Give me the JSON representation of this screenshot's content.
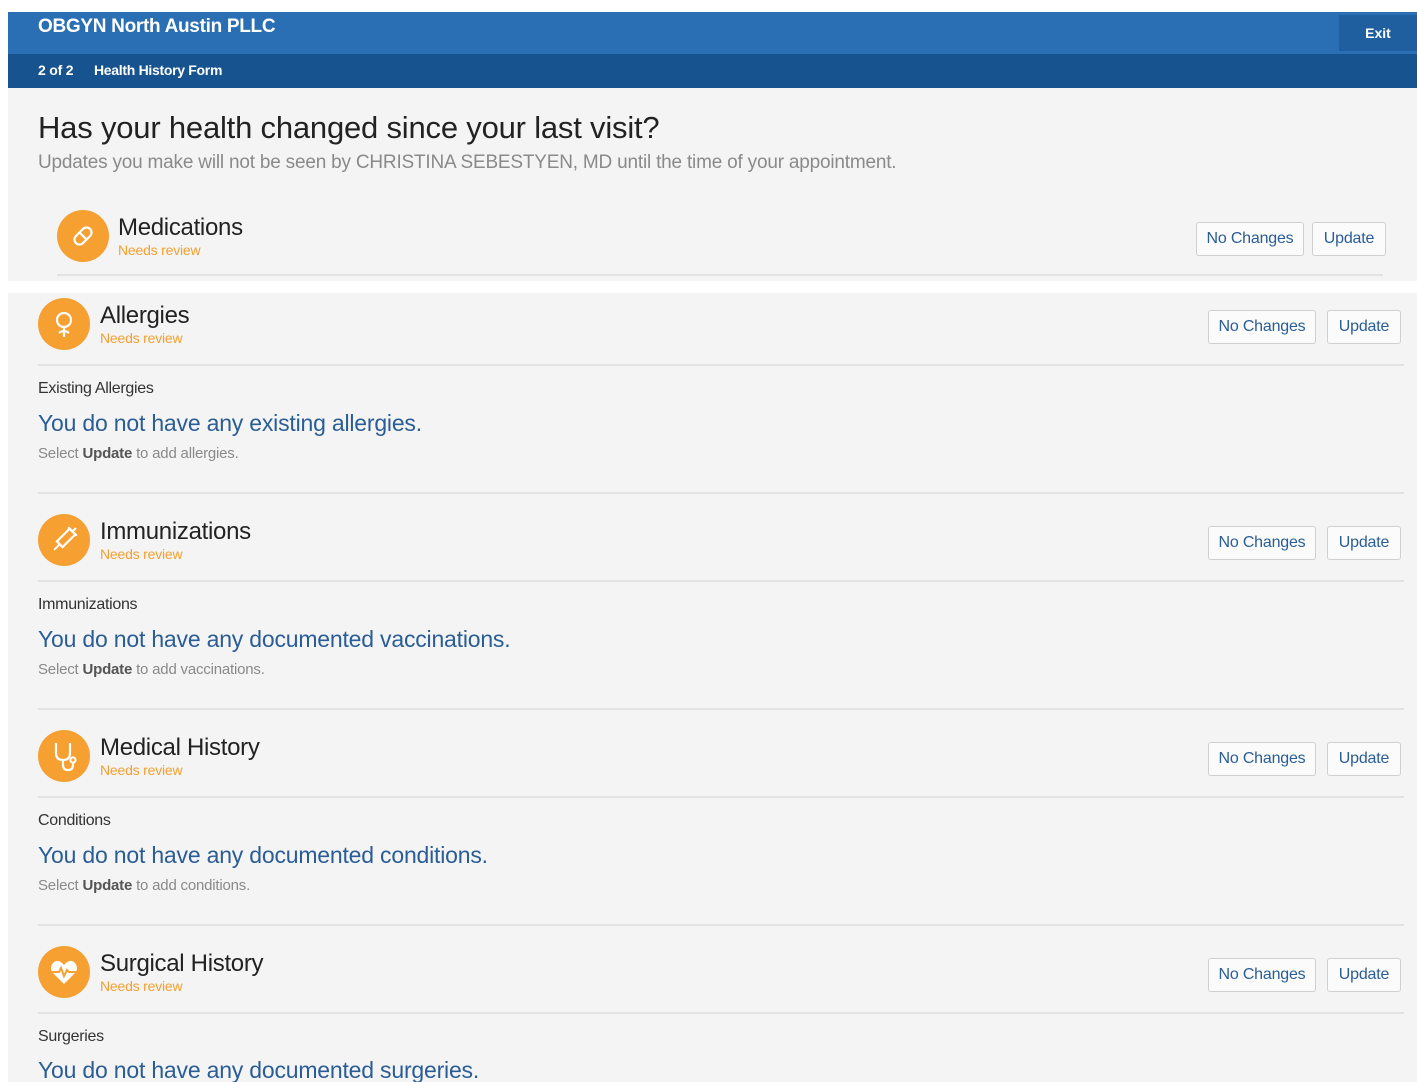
{
  "header": {
    "practice_name": "OBGYN North Austin PLLC",
    "exit_label": "Exit",
    "step": "2 of 2",
    "form_name": "Health History Form"
  },
  "page": {
    "title": "Has your health changed since your last visit?",
    "subtitle": "Updates you make will not be seen by CHRISTINA SEBESTYEN, MD until the time of your appointment."
  },
  "buttons": {
    "no_changes": "No Changes",
    "update": "Update"
  },
  "status_text": "Needs review",
  "colors": {
    "topbar": "#2a6fb3",
    "subbar": "#17538e",
    "accent": "#f5a030",
    "link": "#2a5d96"
  },
  "sections": [
    {
      "title": "Medications",
      "icon": "pill-icon"
    },
    {
      "title": "Allergies",
      "icon": "flower-icon",
      "list_label": "Existing Allergies",
      "empty_message": "You do not have any existing allergies.",
      "hint_prefix": "Select",
      "hint_keyword": "Update",
      "hint_suffix": "to add allergies."
    },
    {
      "title": "Immunizations",
      "icon": "syringe-icon",
      "list_label": "Immunizations",
      "empty_message": "You do not have any documented vaccinations.",
      "hint_prefix": "Select",
      "hint_keyword": "Update",
      "hint_suffix": "to add vaccinations."
    },
    {
      "title": "Medical History",
      "icon": "stethoscope-icon",
      "list_label": "Conditions",
      "empty_message": "You do not have any documented conditions.",
      "hint_prefix": "Select",
      "hint_keyword": "Update",
      "hint_suffix": "to add conditions."
    },
    {
      "title": "Surgical History",
      "icon": "heartbeat-icon",
      "list_label": "Surgeries",
      "empty_message": "You do not have any documented surgeries."
    }
  ]
}
